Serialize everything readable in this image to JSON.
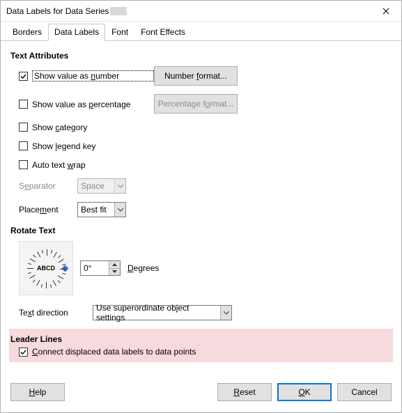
{
  "title": "Data Labels for Data Series",
  "tabs": {
    "borders": "Borders",
    "data_labels": "Data Labels",
    "font": "Font",
    "font_effects": "Font Effects"
  },
  "sections": {
    "text_attributes": "Text Attributes",
    "rotate_text": "Rotate Text",
    "leader_lines": "Leader Lines"
  },
  "attrs": {
    "show_number": {
      "pre": "Show value as ",
      "u": "n",
      "post": "umber"
    },
    "show_percent": {
      "pre": "Show value as ",
      "u": "p",
      "post": "ercentage"
    },
    "show_category": {
      "pre": "Show ",
      "u": "c",
      "post": "ategory"
    },
    "show_legend": {
      "pre": "Show ",
      "u": "l",
      "post": "egend key"
    },
    "auto_wrap": {
      "pre": "Auto text ",
      "u": "w",
      "post": "rap"
    }
  },
  "buttons": {
    "number_format": {
      "pre": "Number ",
      "u": "f",
      "post": "ormat..."
    },
    "percent_format": {
      "pre": "Percentage f",
      "u": "o",
      "post": "rmat..."
    }
  },
  "fields": {
    "separator_label": {
      "pre": "S",
      "u": "e",
      "post": "parator"
    },
    "separator_value": "Space",
    "placement_label": {
      "pre": "Place",
      "u": "m",
      "post": "ent"
    },
    "placement_value": "Best fit",
    "degrees_value": "0°",
    "degrees_label": {
      "pre": "",
      "u": "D",
      "post": "egrees"
    },
    "text_dir_label": {
      "pre": "Te",
      "u": "x",
      "post": "t direction"
    },
    "text_dir_value": "Use superordinate object settings"
  },
  "dial_label": "ABCD",
  "leader": {
    "pre": "",
    "u": "C",
    "post": "onnect displaced data labels to data points"
  },
  "dlg": {
    "help": {
      "pre": "",
      "u": "H",
      "post": "elp"
    },
    "reset": {
      "pre": "",
      "u": "R",
      "post": "eset"
    },
    "ok": {
      "pre": "",
      "u": "O",
      "post": "K"
    },
    "cancel": "Cancel"
  }
}
